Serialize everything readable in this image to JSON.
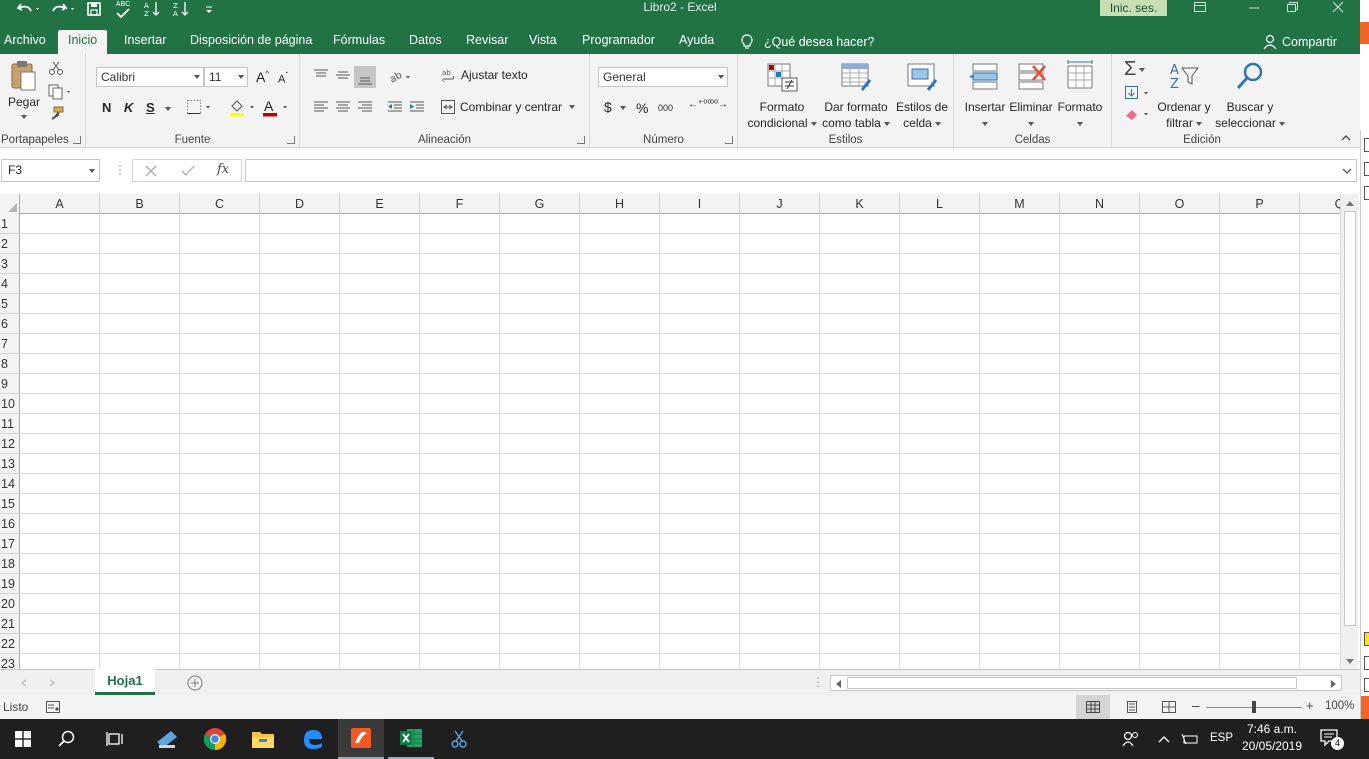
{
  "app": {
    "title": "Libro2  -  Excel",
    "signin": "Inic. ses.",
    "colors": {
      "brand": "#217346",
      "taskbar": "#1f1f1f",
      "accent_orange": "#f26522"
    }
  },
  "quick_access": {
    "icons": [
      "undo-icon",
      "redo-icon",
      "save-icon",
      "spelling-icon",
      "sort-ascending-icon",
      "sort-descending-icon",
      "customize-icon"
    ],
    "spelling_label": "ABC"
  },
  "tabs": [
    "Archivo",
    "Inicio",
    "Insertar",
    "Disposición de página",
    "Fórmulas",
    "Datos",
    "Revisar",
    "Vista",
    "Programador",
    "Ayuda"
  ],
  "active_tab": "Inicio",
  "tell_me": "¿Qué desea hacer?",
  "share": "Compartir",
  "ribbon": {
    "portapapeles": {
      "label": "Portapapeles",
      "paste": "Pegar"
    },
    "fuente": {
      "label": "Fuente",
      "font": "Calibri",
      "size": "11",
      "bold": "N",
      "italic": "K",
      "underline": "S",
      "grow": "A",
      "shrink": "A",
      "font_color_letter": "A"
    },
    "alineacion": {
      "label": "Alineación",
      "wrap": "Ajustar texto",
      "merge": "Combinar y centrar"
    },
    "numero": {
      "label": "Número",
      "format": "General",
      "currency": "$",
      "percent": "%",
      "thousands": "000",
      "inc_decimal": "⁺⁰⁰",
      "dec_decimal": "⁰⁰"
    },
    "estilos": {
      "label": "Estilos",
      "cond_l1": "Formato",
      "cond_l2": "condicional",
      "table_l1": "Dar formato",
      "table_l2": "como tabla",
      "cell_l1": "Estilos de",
      "cell_l2": "celda"
    },
    "celdas": {
      "label": "Celdas",
      "insert": "Insertar",
      "delete": "Eliminar",
      "format": "Formato"
    },
    "edicion": {
      "label": "Edición",
      "sort_l1": "Ordenar y",
      "sort_l2": "filtrar",
      "find_l1": "Buscar y",
      "find_l2": "seleccionar",
      "sum": "Σ"
    }
  },
  "formula_bar": {
    "name_box": "F3",
    "fx": "fx",
    "value": ""
  },
  "grid": {
    "columns": [
      "A",
      "B",
      "C",
      "D",
      "E",
      "F",
      "G",
      "H",
      "I",
      "J",
      "K",
      "L",
      "M",
      "N",
      "O",
      "P",
      "Q"
    ],
    "rows": [
      "1",
      "2",
      "3",
      "4",
      "5",
      "6",
      "7",
      "8",
      "9",
      "10",
      "11",
      "12",
      "13",
      "14",
      "15",
      "16",
      "17",
      "18",
      "19",
      "20",
      "21",
      "22",
      "23"
    ]
  },
  "sheets": [
    "Hoja1"
  ],
  "status": {
    "ready": "Listo",
    "zoom": "100%"
  },
  "taskbar": {
    "time": "7:46 a.m.",
    "date": "20/05/2019",
    "lang": "ESP",
    "notifications": "4"
  }
}
